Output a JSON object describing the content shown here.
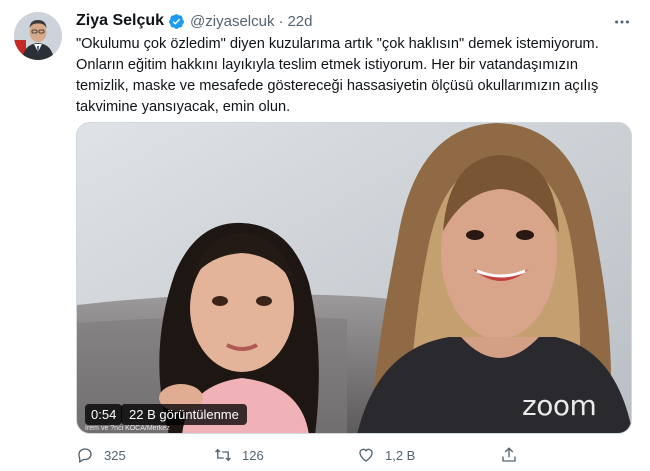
{
  "tweet": {
    "author_name": "Ziya Selçuk",
    "handle": "@ziyaselcuk",
    "separator": "·",
    "time": "22d",
    "lines": [
      "\"Okulumu çok özledim\" diyen kuzularıma artık \"çok haklısın\" demek istemiyorum.",
      "Onların eğitim hakkını layıkıyla teslim etmek istiyorum. Her bir vatandaşımızın",
      "temizlik, maske ve mesafede göstereceği hassasiyetin ölçüsü okullarımızın açılış",
      "takvimine yansıyacak, emin olun."
    ]
  },
  "media": {
    "duration": "0:54",
    "views": "22 B görüntülenme",
    "caption": "Irem ve ?nci KOCA/Merkez",
    "logo": "zoom"
  },
  "actions": {
    "replies": "325",
    "retweets": "126",
    "likes": "1,2 B"
  },
  "colors": {
    "text": "#0f1419",
    "secondary": "#536471",
    "verified": "#1d9bf0"
  },
  "icons": [
    "verified-badge-icon",
    "more-icon",
    "reply-icon",
    "retweet-icon",
    "like-icon",
    "share-icon"
  ]
}
